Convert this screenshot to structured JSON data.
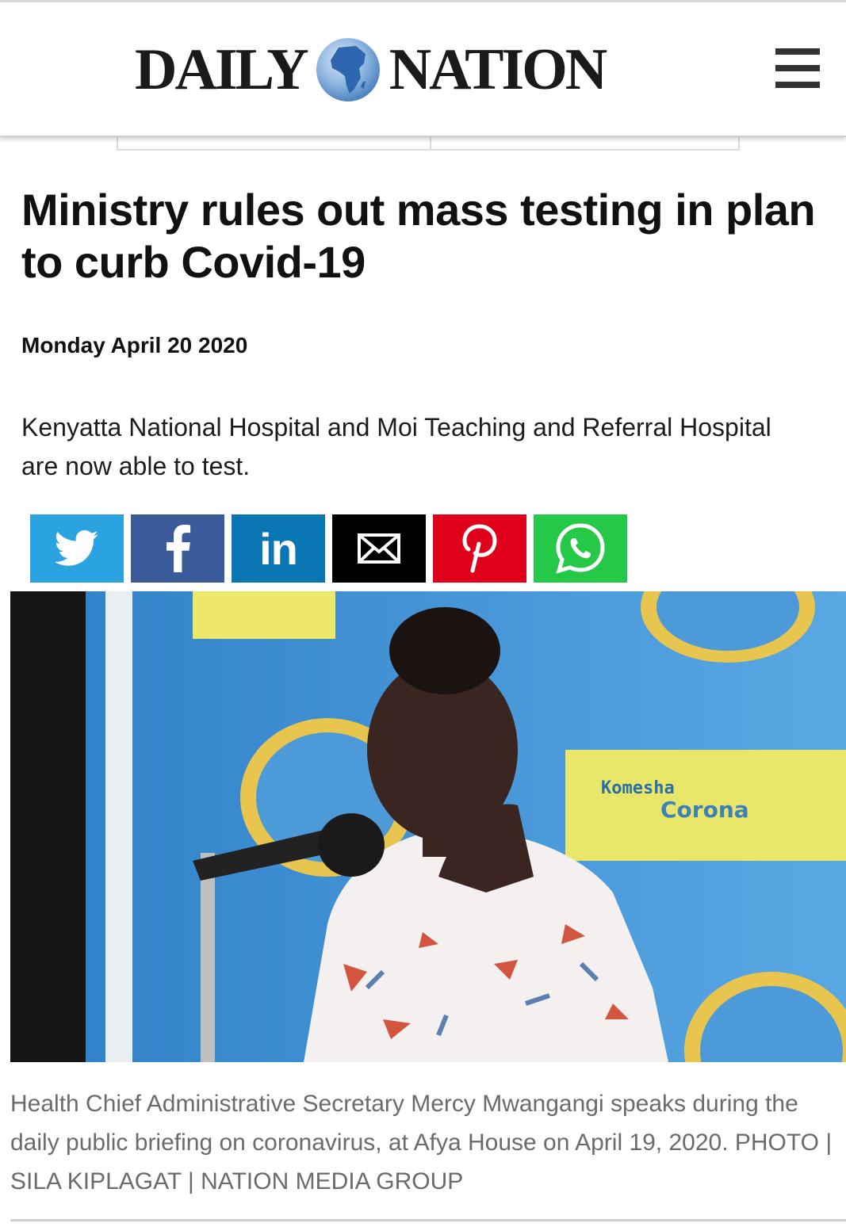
{
  "header": {
    "logo_left": "DAILY",
    "logo_right": "NATION",
    "logo_icon": "africa-globe-icon",
    "menu_icon": "hamburger-menu-icon"
  },
  "article": {
    "headline": "Ministry rules out mass testing in plan to curb Covid-19",
    "date": "Monday April 20 2020",
    "summary": "Kenyatta National Hospital and Moi Teaching and Referral Hospital are now able to test."
  },
  "share": [
    {
      "name": "twitter",
      "icon": "twitter-bird-icon",
      "color": "#2aa3e0"
    },
    {
      "name": "facebook",
      "icon": "facebook-f-icon",
      "color": "#3b5a9a"
    },
    {
      "name": "linkedin",
      "icon": "linkedin-in-icon",
      "color": "#0b76b4",
      "label": "in"
    },
    {
      "name": "email",
      "icon": "envelope-icon",
      "color": "#000000"
    },
    {
      "name": "pinterest",
      "icon": "pinterest-p-icon",
      "color": "#e0001b"
    },
    {
      "name": "whatsapp",
      "icon": "whatsapp-icon",
      "color": "#25c847"
    }
  ],
  "photo": {
    "banner_text_1": "Komesha",
    "banner_text_2": "Corona"
  },
  "caption": "Health Chief Administrative Secretary Mercy Mwangangi speaks during the daily public briefing on coronavirus, at Afya House on April 19, 2020. PHOTO | SILA KIPLAGAT | NATION MEDIA GROUP"
}
